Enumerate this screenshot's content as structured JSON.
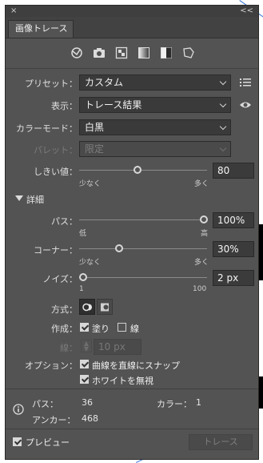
{
  "panel": {
    "close_symbol": "×",
    "collapse_symbol": "<<",
    "tab_title": "画像トレース",
    "icons": [
      "auto-color-preset-icon",
      "camera-icon",
      "grid-preset-icon",
      "grayscale-icon",
      "black-white-icon",
      "outline-icon"
    ]
  },
  "preset": {
    "label": "プリセット：",
    "value": "カスタム"
  },
  "view": {
    "label": "表示：",
    "value": "トレース結果"
  },
  "mode": {
    "label": "カラーモード：",
    "value": "白黒"
  },
  "palette": {
    "label": "パレット：",
    "value": "限定"
  },
  "threshold": {
    "label": "しきい値：",
    "value": "80",
    "min_label": "少なく",
    "max_label": "多く",
    "fraction": 0.45
  },
  "details": {
    "label": "詳細"
  },
  "paths": {
    "label": "パス：",
    "value": "100%",
    "min_label": "低",
    "max_label": "高",
    "fraction": 1.0
  },
  "corners": {
    "label": "コーナー：",
    "value": "30%",
    "min_label": "少なく",
    "max_label": "多く",
    "fraction": 0.3
  },
  "noise": {
    "label": "ノイズ：",
    "value": "2 px",
    "min_label": "1",
    "max_label": "100",
    "fraction": 0.0
  },
  "method": {
    "label": "方式："
  },
  "create": {
    "label": "作成：",
    "fill_label": "塗り",
    "stroke_label": "線",
    "fill_checked": true,
    "stroke_checked": false
  },
  "stroke": {
    "label": "線：",
    "value": "10 px"
  },
  "options": {
    "label": "オプション：",
    "snap_label": "曲線を直線にスナップ",
    "ignore_white_label": "ホワイトを無視",
    "snap_checked": true,
    "ignore_white_checked": true
  },
  "info": {
    "paths_label": "パス：",
    "paths_value": "36",
    "colors_label": "カラー：",
    "colors_value": "1",
    "anchors_label": "アンカー：",
    "anchors_value": "468"
  },
  "preview": {
    "label": "プレビュー",
    "checked": true
  },
  "trace_button": {
    "label": "トレース"
  }
}
